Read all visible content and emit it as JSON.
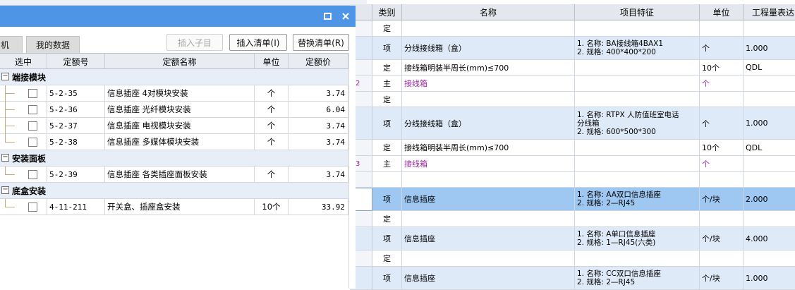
{
  "background": {
    "columns": {
      "category": "类别",
      "name": "名称",
      "feature": "项目特征",
      "unit": "单位",
      "expr": "工程量表达"
    },
    "rows": [
      {
        "style": "light",
        "h": 23,
        "idx": "",
        "cat": "定",
        "name": "",
        "feature": [],
        "unit": "",
        "expr": "",
        "purple": false
      },
      {
        "style": "blue",
        "h": 33,
        "idx": "",
        "cat": "项",
        "name": "分线接线箱（盒）",
        "feature": [
          "1. 名称: BA接线箱4BAX1",
          "2. 规格: 400*400*200"
        ],
        "unit": "个",
        "expr": "1.000",
        "purple": false
      },
      {
        "style": "light",
        "h": 22,
        "idx": "",
        "cat": "定",
        "name": "接线箱明装半周长(mm)≤700",
        "feature": [],
        "unit": "10个",
        "expr": "QDL",
        "purple": false
      },
      {
        "style": "light",
        "h": 23,
        "idx": "2",
        "cat": "主",
        "name": "接线箱",
        "feature": [],
        "unit": "个",
        "expr": "",
        "purple": true
      },
      {
        "style": "light",
        "h": 22,
        "idx": "",
        "cat": "定",
        "name": "",
        "feature": [],
        "unit": "",
        "expr": "",
        "purple": false
      },
      {
        "style": "blue",
        "h": 46,
        "idx": "",
        "cat": "项",
        "name": "分线接线箱（盒）",
        "feature": [
          "1. 名称: RTPX 人防值班室电话",
          "分线箱",
          "2. 规格: 600*500*300"
        ],
        "unit": "个",
        "expr": "1.000",
        "purple": false
      },
      {
        "style": "light",
        "h": 23,
        "idx": "",
        "cat": "定",
        "name": "接线箱明装半周长(mm)≤700",
        "feature": [],
        "unit": "10个",
        "expr": "QDL",
        "purple": false
      },
      {
        "style": "light",
        "h": 23,
        "idx": "3",
        "cat": "主",
        "name": "接线箱",
        "feature": [],
        "unit": "个",
        "expr": "",
        "purple": true
      },
      {
        "style": "light",
        "h": 22,
        "idx": "",
        "cat": "",
        "name": "",
        "feature": [],
        "unit": "",
        "expr": "",
        "purple": false
      },
      {
        "style": "sel",
        "h": 33,
        "idx": "",
        "cat": "项",
        "name": "信息插座",
        "feature": [
          "1. 名称: AA双口信息插座",
          "2. 规格: 2—RJ45"
        ],
        "unit": "个/块",
        "expr": "2.000",
        "purple": false
      },
      {
        "style": "light",
        "h": 23,
        "idx": "",
        "cat": "定",
        "name": "",
        "feature": [],
        "unit": "",
        "expr": "",
        "purple": false
      },
      {
        "style": "blue",
        "h": 33,
        "idx": "",
        "cat": "项",
        "name": "信息插座",
        "feature": [
          "1. 名称: A单口信息插座",
          "2. 规格: 1—RJ45(六类)"
        ],
        "unit": "个/块",
        "expr": "4.000",
        "purple": false
      },
      {
        "style": "light",
        "h": 23,
        "idx": "",
        "cat": "定",
        "name": "",
        "feature": [],
        "unit": "",
        "expr": "",
        "purple": false
      },
      {
        "style": "blue",
        "h": 33,
        "idx": "",
        "cat": "项",
        "name": "信息插座",
        "feature": [
          "1. 名称: CC双口信息插座",
          "2. 规格: 2—RJ45"
        ],
        "unit": "个/块",
        "expr": "1.000",
        "purple": false
      }
    ]
  },
  "dialog": {
    "tabs": [
      "机",
      "我的数据"
    ],
    "buttons": {
      "insert_child": "插入子目",
      "insert_list": "插入清单(I)",
      "replace_list": "替换清单(R)"
    },
    "columns": {
      "select": "选中",
      "code": "定额号",
      "name": "定额名称",
      "unit": "单位",
      "price": "定额价"
    },
    "groups": [
      {
        "title": "端接模块",
        "rows": [
          {
            "code": "5-2-35",
            "name": "信息插座 4对模块安装",
            "unit": "个",
            "price": "3.74"
          },
          {
            "code": "5-2-36",
            "name": "信息插座 光纤模块安装",
            "unit": "个",
            "price": "6.04"
          },
          {
            "code": "5-2-37",
            "name": "信息插座 电视模块安装",
            "unit": "个",
            "price": "3.74"
          },
          {
            "code": "5-2-38",
            "name": "信息插座 多媒体模块安装",
            "unit": "个",
            "price": "3.74"
          }
        ]
      },
      {
        "title": "安装面板",
        "rows": [
          {
            "code": "5-2-39",
            "name": "信息插座 各类插座面板安装",
            "unit": "个",
            "price": "3.74"
          }
        ]
      },
      {
        "title": "底盒安装",
        "rows": [
          {
            "code": "4-11-211",
            "name": "开关盒、插座盒安装",
            "unit": "10个",
            "price": "33.92"
          }
        ]
      }
    ]
  },
  "colors": {
    "titlebar": "#4e95e6",
    "selected_row": "#9ec7f2",
    "group_row": "#e7eef7",
    "purple_text": "#9a2aa3"
  },
  "icons": {
    "maximize": "maximize-icon",
    "close": "close-icon",
    "collapse": "collapse-minus-icon",
    "checkbox": "checkbox-icon"
  }
}
